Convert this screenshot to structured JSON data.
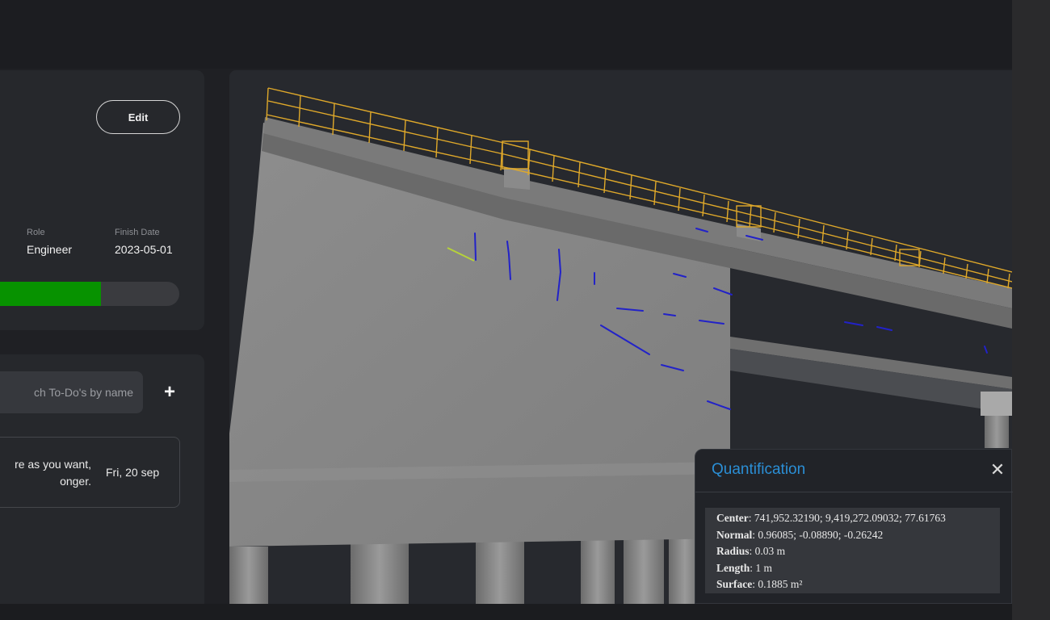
{
  "project_card": {
    "edit_label": "Edit",
    "role_label": "Role",
    "role_value": "Engineer",
    "finish_label": "Finish Date",
    "finish_value": "2023-05-01",
    "progress_percent": 60,
    "progress_color": "#079200"
  },
  "todo": {
    "search_placeholder": "ch To-Do's by name",
    "add_label": "+",
    "items": [
      {
        "text": "re as you want, onger.",
        "date": "Fri, 20 sep"
      }
    ]
  },
  "quantification": {
    "title": "Quantification",
    "close_label": "✕",
    "rows": [
      {
        "label": "Center",
        "value": ": 741,952.32190; 9,419,272.09032; 77.61763"
      },
      {
        "label": "Normal",
        "value": ": 0.96085; -0.08890; -0.26242"
      },
      {
        "label": "Radius",
        "value": ": 0.03 m"
      },
      {
        "label": "Length",
        "value": ": 1 m"
      },
      {
        "label": "Surface",
        "value": ": 0.1885 m²"
      }
    ],
    "title_color": "#2b8fd6"
  },
  "colors": {
    "railing": "#e0a92a",
    "crack": "#2222c8",
    "selected_crack": "#b6d23a"
  }
}
